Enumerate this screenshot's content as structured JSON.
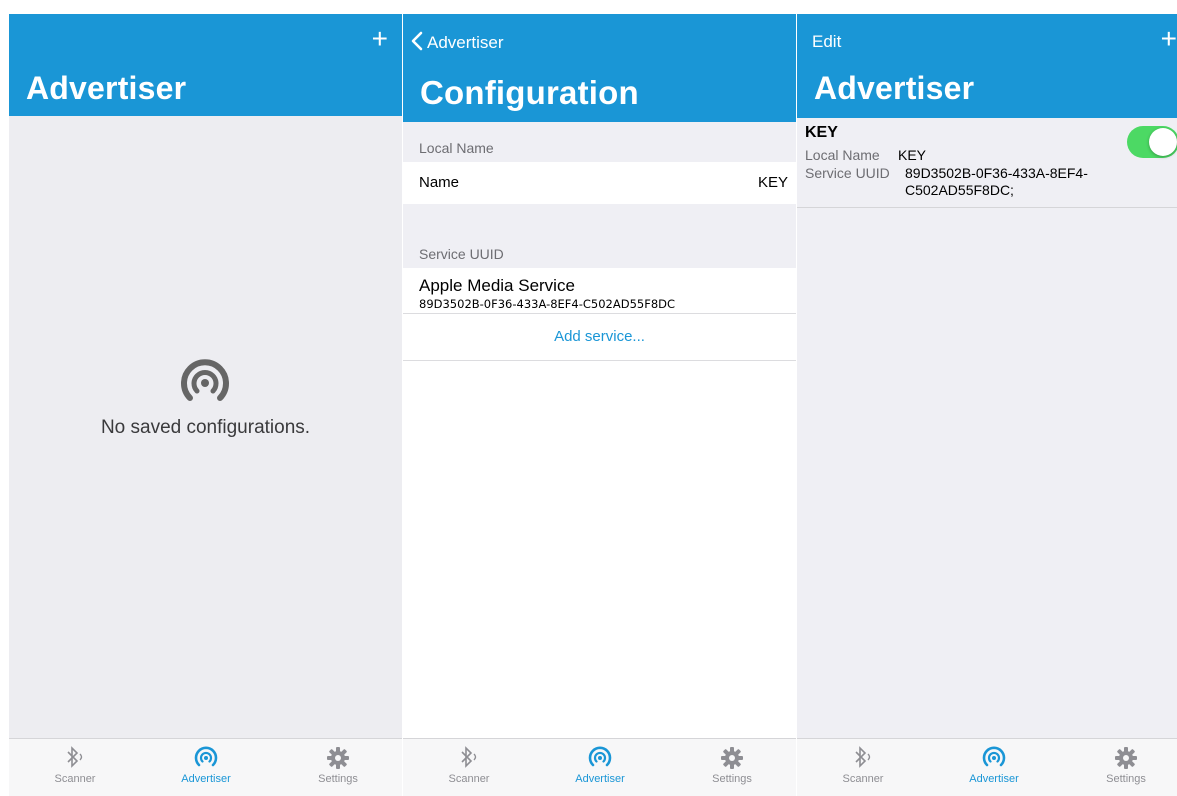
{
  "screen1": {
    "title": "Advertiser",
    "plus_label": "+",
    "empty_text": "No saved configurations."
  },
  "screen2": {
    "back_label": "Advertiser",
    "title": "Configuration",
    "local_name_header": "Local Name",
    "name_label": "Name",
    "name_value": "KEY",
    "service_uuid_header": "Service UUID",
    "service_name": "Apple Media Service",
    "service_uuid": "89D3502B-0F36-433A-8EF4-C502AD55F8DC",
    "add_service_label": "Add service..."
  },
  "screen3": {
    "edit_label": "Edit",
    "title": "Advertiser",
    "plus_label": "+",
    "item": {
      "name": "KEY",
      "local_name_key": "Local Name",
      "local_name_value": "KEY",
      "service_uuid_key": "Service UUID",
      "service_uuid_line1": "89D3502B-0F36-433A-8EF4-",
      "service_uuid_line2": "C502AD55F8DC;",
      "enabled": true
    }
  },
  "tabbar": {
    "tabs": [
      {
        "label": "Scanner",
        "icon": "bluetooth-icon"
      },
      {
        "label": "Advertiser",
        "icon": "broadcast-icon"
      },
      {
        "label": "Settings",
        "icon": "gear-icon"
      }
    ],
    "active_index": 1
  },
  "colors": {
    "accent": "#1a96d6",
    "toggle_on": "#4cd964",
    "inactive_tab": "#8e8e93"
  }
}
